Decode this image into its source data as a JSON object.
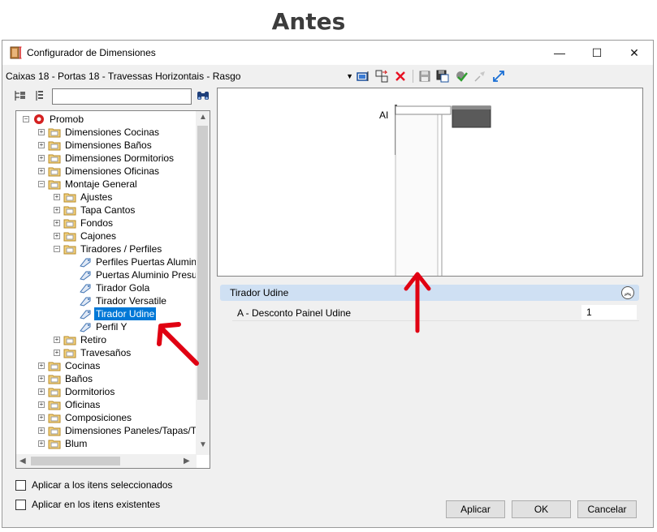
{
  "heading": "Antes",
  "window": {
    "title": "Configurador de Dimensiones",
    "minimize_label": "—",
    "maximize_label": "☐",
    "close_label": "✕"
  },
  "config_select": {
    "value": "Caixas 18 - Portas 18 - Travessas Horizontais - Rasgo"
  },
  "toolbar": {
    "icons": [
      "select-icon",
      "move-icon",
      "delete-icon",
      "save-icon",
      "save-as-icon",
      "apply-check-icon",
      "pin-icon",
      "expand-icon"
    ],
    "delete_color": "#e81123"
  },
  "search": {
    "value": ""
  },
  "tree": {
    "root_label": "Promob",
    "items": [
      {
        "label": "Dimensiones Cocinas"
      },
      {
        "label": "Dimensiones Baños"
      },
      {
        "label": "Dimensiones Dormitorios"
      },
      {
        "label": "Dimensiones Oficinas"
      },
      {
        "label": "Montaje General"
      },
      {
        "label": "Ajustes"
      },
      {
        "label": "Tapa Cantos"
      },
      {
        "label": "Fondos"
      },
      {
        "label": "Cajones"
      },
      {
        "label": "Tiradores / Perfiles"
      },
      {
        "label": "Perfiles Puertas Aluminio"
      },
      {
        "label": "Puertas Aluminio Presupu"
      },
      {
        "label": "Tirador Gola"
      },
      {
        "label": "Tirador Versatile"
      },
      {
        "label": "Tirador Udine"
      },
      {
        "label": "Perfil Y"
      },
      {
        "label": "Retiro"
      },
      {
        "label": "Travesaños"
      },
      {
        "label": "Cocinas"
      },
      {
        "label": "Baños"
      },
      {
        "label": "Dormitorios"
      },
      {
        "label": "Oficinas"
      },
      {
        "label": "Composiciones"
      },
      {
        "label": "Dimensiones Paneles/Tapas/Tar"
      },
      {
        "label": "Blum"
      }
    ],
    "selected": "Tirador Udine",
    "selection_color": "#0078d7"
  },
  "preview": {
    "dimension_label": "AI"
  },
  "properties": {
    "group_title": "Tirador Udine",
    "rows": [
      {
        "name": "A - Desconto Painel Udine",
        "value": "1"
      }
    ]
  },
  "checkboxes": [
    {
      "label": "Aplicar a los itens seleccionados",
      "checked": false
    },
    {
      "label": "Aplicar en los itens existentes",
      "checked": false
    }
  ],
  "buttons": {
    "apply": "Aplicar",
    "ok": "OK",
    "cancel": "Cancelar"
  },
  "annotation_color": "#e00012"
}
